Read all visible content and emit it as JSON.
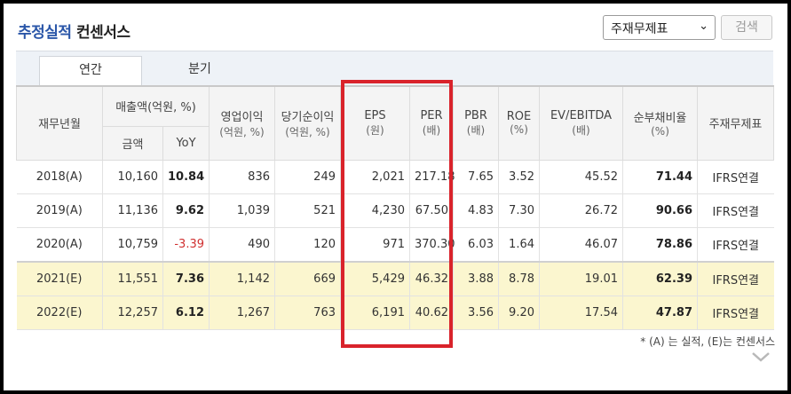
{
  "header": {
    "title_highlight": "추정실적",
    "title_rest": " 컨센서스",
    "select_value": "주재무제표",
    "search_label": "검색"
  },
  "tabs": [
    {
      "label": "연간",
      "active": true
    },
    {
      "label": "분기",
      "active": false
    }
  ],
  "columns": {
    "period": "재무년월",
    "sales": "매출액(억원, %)",
    "sales_amount": "금액",
    "sales_yoy": "YoY",
    "op_income": "영업이익",
    "op_income_unit": "(억원, %)",
    "net_income": "당기순이익",
    "net_income_unit": "(억원, %)",
    "eps": "EPS",
    "eps_unit": "(원)",
    "per": "PER",
    "per_unit": "(배)",
    "pbr": "PBR",
    "pbr_unit": "(배)",
    "roe": "ROE",
    "roe_unit": "(%)",
    "ev": "EV/EBITDA",
    "ev_unit": "(배)",
    "debt": "순부채비율",
    "debt_unit": "(%)",
    "type": "주재무제표"
  },
  "rows": [
    {
      "period": "2018(A)",
      "amount": "10,160",
      "yoy": "10.84",
      "op": "836",
      "net": "249",
      "eps": "2,021",
      "per": "217.18",
      "pbr": "7.65",
      "roe": "3.52",
      "ev": "45.52",
      "debt": "71.44",
      "type": "IFRS연결"
    },
    {
      "period": "2019(A)",
      "amount": "11,136",
      "yoy": "9.62",
      "op": "1,039",
      "net": "521",
      "eps": "4,230",
      "per": "67.50",
      "pbr": "4.83",
      "roe": "7.30",
      "ev": "26.72",
      "debt": "90.66",
      "type": "IFRS연결"
    },
    {
      "period": "2020(A)",
      "amount": "10,759",
      "yoy": "-3.39",
      "op": "490",
      "net": "120",
      "eps": "971",
      "per": "370.30",
      "pbr": "6.03",
      "roe": "1.64",
      "ev": "46.07",
      "debt": "78.86",
      "type": "IFRS연결"
    },
    {
      "period": "2021(E)",
      "amount": "11,551",
      "yoy": "7.36",
      "op": "1,142",
      "net": "669",
      "eps": "5,429",
      "per": "46.32",
      "pbr": "3.88",
      "roe": "8.78",
      "ev": "19.01",
      "debt": "62.39",
      "type": "IFRS연결"
    },
    {
      "period": "2022(E)",
      "amount": "12,257",
      "yoy": "6.12",
      "op": "1,267",
      "net": "763",
      "eps": "6,191",
      "per": "40.62",
      "pbr": "3.56",
      "roe": "9.20",
      "ev": "17.54",
      "debt": "47.87",
      "type": "IFRS연결"
    }
  ],
  "note": "* (A) 는 실적, (E)는 컨센서스",
  "colors": {
    "accent": "#2a56a8",
    "highlight_box": "#d9232b",
    "estimate_row_bg": "#fbf6cf",
    "negative": "#d03030"
  }
}
